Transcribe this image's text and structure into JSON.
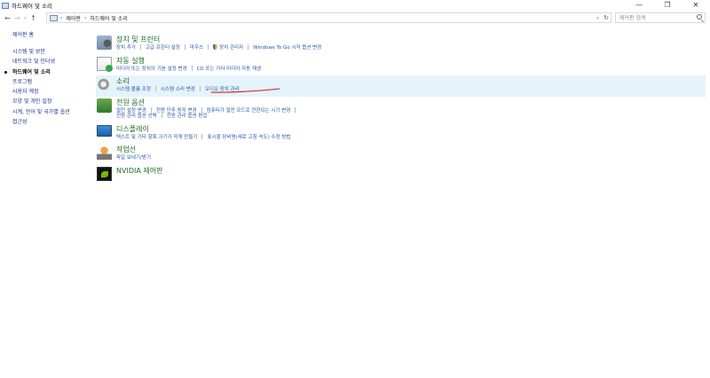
{
  "window": {
    "title": "하드웨어 및 소리",
    "controls": {
      "minimize": "—",
      "restore": "❐",
      "close": "✕"
    }
  },
  "nav": {
    "back": "←",
    "forward": "→",
    "recent": "⌄",
    "up": "↑"
  },
  "address": {
    "crumbs": [
      "제어판",
      "하드웨어 및 소리"
    ],
    "separator": "›",
    "dropdown": "⌄",
    "refresh": "↻"
  },
  "search": {
    "placeholder": "제어판 검색"
  },
  "left_pane": {
    "home": "제어판 홈",
    "items": [
      {
        "label": "시스템 및 보안",
        "current": false
      },
      {
        "label": "네트워크 및 인터넷",
        "current": false
      },
      {
        "label": "하드웨어 및 소리",
        "current": true
      },
      {
        "label": "프로그램",
        "current": false
      },
      {
        "label": "사용자 계정",
        "current": false
      },
      {
        "label": "모양 및 개인 설정",
        "current": false
      },
      {
        "label": "시계, 언어 및 국가별 옵션",
        "current": false
      },
      {
        "label": "접근성",
        "current": false
      }
    ]
  },
  "categories": [
    {
      "title": "장치 및 프린터",
      "icon": "devices-printers-icon",
      "links": [
        "장치 추가",
        "고급 프린터 설정",
        "마우스",
        "장치 관리자",
        "Windows To Go 시작 옵션 변경"
      ]
    },
    {
      "title": "자동 실행",
      "icon": "autoplay-icon",
      "links": [
        "미디어 또는 장치의 기본 설정 변경",
        "CD 또는 기타 미디어 자동 재생"
      ]
    },
    {
      "title": "소리",
      "icon": "sound-icon",
      "highlighted": true,
      "links": [
        "시스템 볼륨 조정",
        "시스템 소리 변경",
        "오디오 장치 관리"
      ]
    },
    {
      "title": "전원 옵션",
      "icon": "power-options-icon",
      "links": [
        "절전 설정 변경",
        "전원 단추 동작 변경",
        "컴퓨터가 절전 모드로 전환되는 시기 변경"
      ],
      "links_row2": [
        "전원 관리 옵션 선택",
        "전원 관리 옵션 편집"
      ]
    },
    {
      "title": "디스플레이",
      "icon": "display-icon",
      "links": [
        "텍스트 및 기타 항목 크기가 작게 만들기",
        "표시할 장비명(새로 고침 속도) 수정 방법"
      ]
    },
    {
      "title": "작업선",
      "icon": "location-icon",
      "links": [
        "파일 보내기/받기"
      ]
    },
    {
      "title": "NVIDIA 제어판",
      "icon": "nvidia-icon",
      "links": []
    }
  ],
  "annotation": {
    "color": "#d11d1d"
  }
}
